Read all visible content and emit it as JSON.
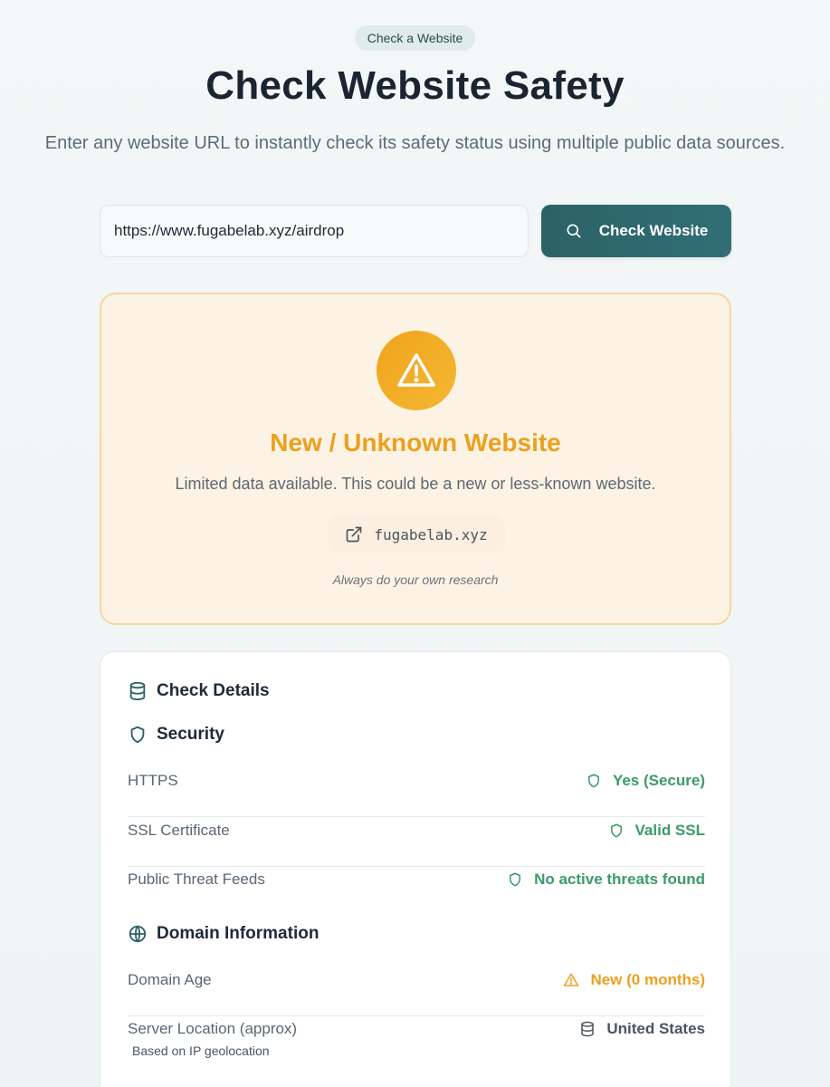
{
  "header": {
    "pill": "Check a Website",
    "title": "Check Website Safety",
    "subtitle": "Enter any website URL to instantly check its safety status using multiple public data sources."
  },
  "search": {
    "value": "https://www.fugabelab.xyz/airdrop",
    "button_label": "Check Website"
  },
  "result": {
    "title": "New / Unknown Website",
    "description": "Limited data available. This could be a new or less-known website.",
    "domain": "fugabelab.xyz",
    "note": "Always do your own research",
    "accent_color": "#eca01e"
  },
  "details": {
    "title": "Check Details",
    "security": {
      "title": "Security",
      "rows": [
        {
          "label": "HTTPS",
          "value": "Yes (Secure)",
          "status": "good"
        },
        {
          "label": "SSL Certificate",
          "value": "Valid SSL",
          "status": "good"
        },
        {
          "label": "Public Threat Feeds",
          "value": "No active threats found",
          "status": "good"
        }
      ]
    },
    "domain_info": {
      "title": "Domain Information",
      "rows": [
        {
          "label": "Domain Age",
          "value": "New (0 months)",
          "status": "warn"
        },
        {
          "label": "Server Location (approx)",
          "value": "United States",
          "sub": "Based on IP geolocation",
          "status": "neutral"
        }
      ]
    }
  },
  "colors": {
    "primary": "#2c6266",
    "good": "#3b9b6a",
    "warn": "#eca01e"
  }
}
